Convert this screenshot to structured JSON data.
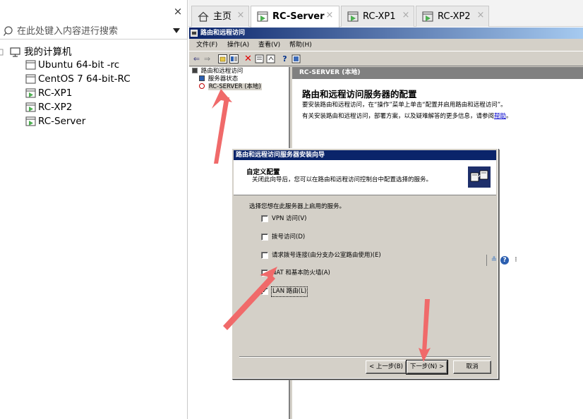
{
  "left_panel": {
    "close_label": "×",
    "search_placeholder": "在此处键入内容进行搜索",
    "tree": {
      "root": "我的计算机",
      "items": [
        "Ubuntu 64-bit -rc",
        "CentOS 7 64-bit-RC",
        "RC-XP1",
        "RC-XP2",
        "RC-Server"
      ]
    }
  },
  "tabs": [
    {
      "label": "主页",
      "icon": "home-icon"
    },
    {
      "label": "RC-Server",
      "icon": "vm-running-icon",
      "active": true
    },
    {
      "label": "RC-XP1",
      "icon": "vm-running-icon"
    },
    {
      "label": "RC-XP2",
      "icon": "vm-running-icon"
    }
  ],
  "tab_close": "×",
  "mmc": {
    "title": "路由和远程访问",
    "menu": [
      "文件(F)",
      "操作(A)",
      "查看(V)",
      "帮助(H)"
    ],
    "tree": {
      "root": "路由和远程访问",
      "status": "服务器状态",
      "server": "RC-SERVER (本地)"
    },
    "right": {
      "header": "RC-SERVER (本地)",
      "title": "路由和远程访问服务器的配置",
      "line1": "要安装路由和远程访问，在“操作”菜单上单击“配置并启用路由和远程访问”。",
      "line2_pre": "有关安装路由和远程访问，部署方案，以及疑难解答的更多信息，请参阅",
      "line2_link": "帮助",
      "line2_post": "。"
    }
  },
  "wizard": {
    "title": "路由和远程访问服务器安装向导",
    "heading": "自定义配置",
    "subheading": "关闭此向导后，您可以在路由和远程访问控制台中配置选择的服务。",
    "prompt": "选择您想在此服务器上启用的服务。",
    "options": [
      {
        "label": "VPN 访问(V)",
        "checked": false
      },
      {
        "label": "拨号访问(D)",
        "checked": false
      },
      {
        "label": "请求拨号连接(由分支办公室路由使用)(E)",
        "checked": false
      },
      {
        "label": "NAT 和基本防火墙(A)",
        "checked": false
      },
      {
        "label": "LAN 路由(L)",
        "checked": true
      }
    ],
    "check_mark": "✓",
    "back_button": "< 上一步(B)",
    "next_button": "下一步(N) >",
    "cancel_button": "取消"
  },
  "colors": {
    "annotation_arrow": "#f06a6a",
    "title_bar": "#0a246a",
    "vm_running_icon": "#4caf50"
  }
}
